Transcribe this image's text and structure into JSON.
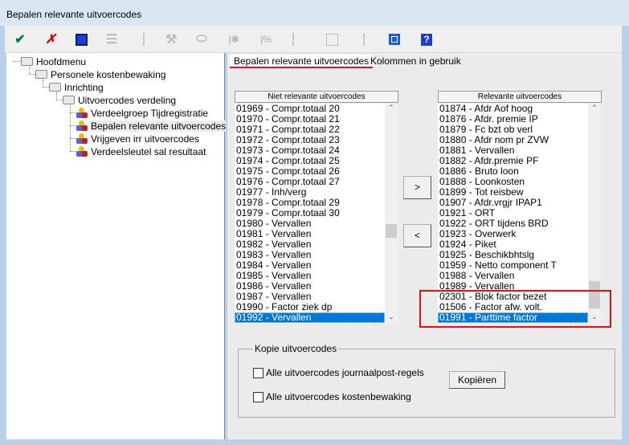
{
  "window": {
    "title": "Bepalen relevante uitvoercodes"
  },
  "toolbar": {
    "icons": [
      "check-icon",
      "cancel-icon",
      "save-icon",
      "list-icon",
      "wrench-icon",
      "eraser-icon",
      "wand-icon",
      "formula-icon",
      "blank-icon",
      "window-icon",
      "help-icon"
    ],
    "accent_ok": "#008040",
    "accent_cancel": "#e00000"
  },
  "tree": {
    "items": [
      {
        "label": "Hoofdmenu",
        "type": "folder"
      },
      {
        "label": "Personele kostenbewaking",
        "type": "folder"
      },
      {
        "label": "Inrichting",
        "type": "folder"
      },
      {
        "label": "Uitvoercodes verdeling",
        "type": "folder"
      },
      {
        "label": "Verdeelgroep Tijdregistratie",
        "type": "item"
      },
      {
        "label": "Bepalen relevante uitvoercodes",
        "type": "item",
        "selected": true
      },
      {
        "label": "Vrijgeven irr uitvoercodes",
        "type": "item"
      },
      {
        "label": "Verdeelsleutel sal resultaat",
        "type": "item"
      }
    ]
  },
  "tabs": [
    {
      "label": "Bepalen relevante uitvoercodes",
      "active": true
    },
    {
      "label": "Kolommen in gebruik"
    }
  ],
  "left_list": {
    "header": "Niet relevante uitvoercodes",
    "items": [
      "01969 - Compr.totaal 20",
      "01970 - Compr.totaal 21",
      "01971 - Compr.totaal 22",
      "01972 - Compr.totaal 23",
      "01973 - Compr.totaal 24",
      "01974 - Compr.totaal 25",
      "01975 - Compr.totaal 26",
      "01976 - Compr.totaal 27",
      "01977 - Inh/verg",
      "01978 - Compr.totaal 29",
      "01979 - Compr.totaal 30",
      "01980 - Vervallen",
      "01981 - Vervallen",
      "01982 - Vervallen",
      "01983 - Vervallen",
      "01984 - Vervallen",
      "01985 - Vervallen",
      "01986 - Vervallen",
      "01987 - Vervallen",
      "01990 - Factor ziek dp",
      "01992 - Vervallen"
    ],
    "selected": "01992 - Vervallen"
  },
  "right_list": {
    "header": "Relevante uitvoercodes",
    "items": [
      "01874 - Afdr Aof hoog",
      "01876 - Afdr. premie IP",
      "01879 - Fc bzt ob verl",
      "01880 - Afdr nom pr ZVW",
      "01881 - Vervallen",
      "01882 - Afdr.premie PF",
      "01886 - Bruto loon",
      "01888 - Loonkosten",
      "01899 - Tot reisbew",
      "01907 - Afdr.vrgjr IPAP1",
      "01921 - ORT",
      "01922 - ORT tijdens BRD",
      "01923 - Overwerk",
      "01924 - Piket",
      "01925 - Beschikbhtslg",
      "01959 - Netto component T",
      "01988 - Vervallen",
      "01989 - Vervallen",
      "02301 - Blok factor bezet",
      "01506 - Factor afw. volt.",
      "01991 - Parttime factor"
    ],
    "selected": "01991 - Parttime factor"
  },
  "buttons": {
    "add": ">",
    "remove": "<"
  },
  "copy_group": {
    "title": "Kopie uitvoercodes",
    "checkbox1": "Alle uitvoercodes journaalpost-regels",
    "checkbox2": "Alle uitvoercodes kostenbewaking",
    "checkbox1_checked": false,
    "checkbox2_checked": false,
    "button": "Kopiëren"
  },
  "highlight_color": "#e01010"
}
